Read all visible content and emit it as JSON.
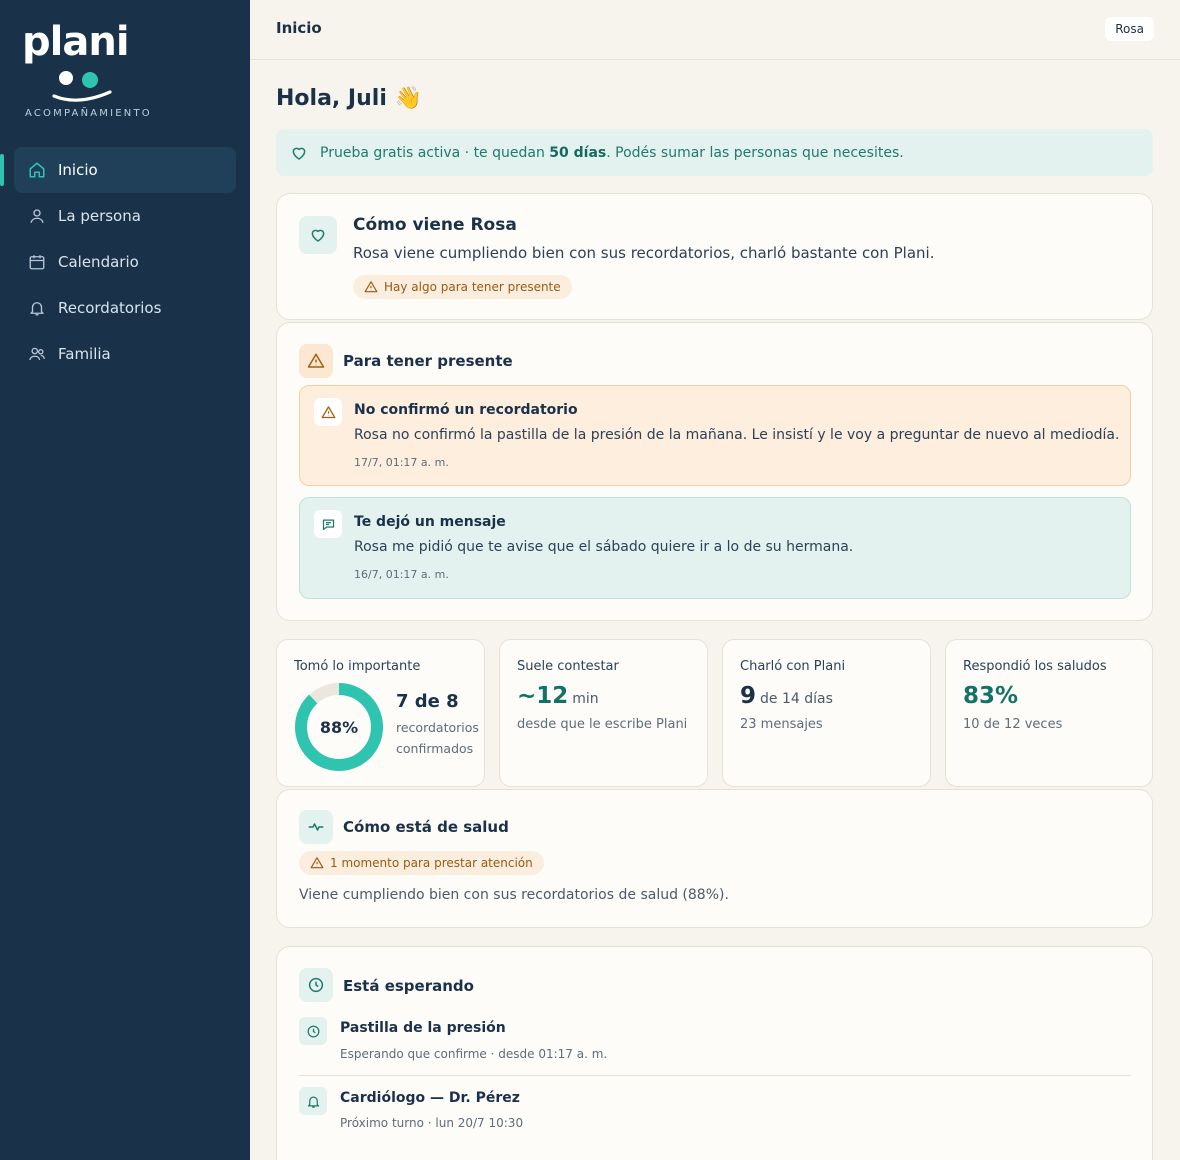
{
  "brand": {
    "name": "plani",
    "tagline": "ACOMPAÑAMIENTO",
    "accent": "#2ec4b0",
    "sidebar_bg": "#1a3249"
  },
  "sidebar": {
    "items": [
      {
        "label": "Inicio",
        "icon": "home-icon",
        "active": true
      },
      {
        "label": "La persona",
        "icon": "user-icon",
        "active": false
      },
      {
        "label": "Calendario",
        "icon": "calendar-icon",
        "active": false
      },
      {
        "label": "Recordatorios",
        "icon": "bell-icon",
        "active": false
      },
      {
        "label": "Familia",
        "icon": "users-icon",
        "active": false
      }
    ]
  },
  "header": {
    "title": "Inicio",
    "user": "Rosa"
  },
  "greeting": "Hola, Juli 👋",
  "trial": {
    "prefix": "Prueba gratis activa · te quedan ",
    "days": "50 días",
    "suffix": ". Podés sumar las personas que necesites."
  },
  "summary": {
    "title": "Cómo viene Rosa",
    "text": "Rosa viene cumpliendo bien con sus recordatorios, charló bastante con Plani.",
    "badge": "Hay algo para tener presente"
  },
  "attention": {
    "title": "Para tener presente",
    "items": [
      {
        "title": "No confirmó un recordatorio",
        "body": "Rosa no confirmó la pastilla de la presión de la mañana. Le insistí y le voy a preguntar de nuevo al mediodía.",
        "date": "17/7, 01:17 a. m.",
        "type": "warning"
      },
      {
        "title": "Te dejó un mensaje",
        "body": "Rosa me pidió que te avise que el sábado quiere ir a lo de su hermana.",
        "date": "16/7, 01:17 a. m.",
        "type": "message"
      }
    ]
  },
  "stats": {
    "adherence": {
      "label": "Tomó lo importante",
      "percent_value": 88,
      "percent_label": "88%",
      "big": "7 de 8",
      "sub1": "recordatorios",
      "sub2": "confirmados"
    },
    "response": {
      "label": "Suele contestar",
      "big": "~12",
      "unit": "min",
      "sub": "desde que le escribe Plani"
    },
    "chat": {
      "label": "Charló con Plani",
      "big": "9",
      "unit": "de 14 días",
      "sub": "23 mensajes"
    },
    "greetings": {
      "label": "Respondió los saludos",
      "big": "83%",
      "sub": "10 de 12 veces"
    }
  },
  "health": {
    "title": "Cómo está de salud",
    "badge": "1 momento para prestar atención",
    "text": "Viene cumpliendo bien con sus recordatorios de salud (88%)."
  },
  "waiting": {
    "title": "Está esperando",
    "items": [
      {
        "title": "Pastilla de la presión",
        "sub": "Esperando que confirme · desde 01:17 a. m.",
        "icon": "clock-icon"
      },
      {
        "title": "Cardiólogo — Dr. Pérez",
        "sub": "Próximo turno · lun 20/7 10:30",
        "icon": "bell-icon"
      }
    ]
  }
}
